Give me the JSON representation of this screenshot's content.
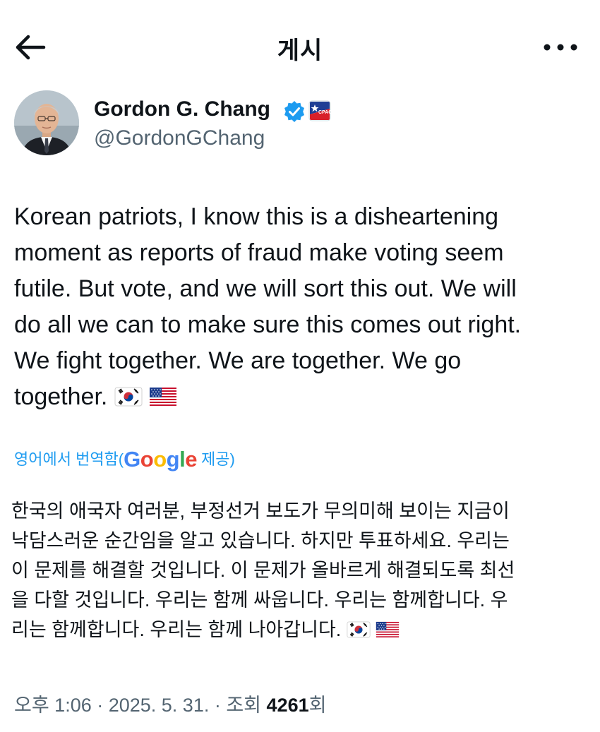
{
  "header": {
    "title": "게시",
    "back_icon": "arrow-left-icon",
    "more_icon": "more-horizontal-icon"
  },
  "author": {
    "name": "Gordon G. Chang",
    "handle": "@GordonGChang",
    "verified_color": "#1d9bf0",
    "affiliation_badge": "CPAC"
  },
  "tweet": {
    "text": "Korean patriots, I know this is a disheartening\nmoment as reports of fraud make voting seem\nfutile. But vote, and we will sort this out. We will\ndo all we can to make sure this comes out right.\nWe fight together. We are together. We go\ntogether.",
    "flags": [
      "kr-flag-icon",
      "us-flag-icon"
    ]
  },
  "translation": {
    "prefix": "영어에서 번역함(",
    "provider": "Google",
    "suffix": " 제공)",
    "text": "한국의 애국자 여러분, 부정선거 보도가 무의미해 보이는 지금이\n낙담스러운 순간임을 알고 있습니다. 하지만 투표하세요. 우리는\n이 문제를 해결할 것입니다. 이 문제가 올바르게 해결되도록 최선\n을 다할 것입니다. 우리는 함께 싸웁니다. 우리는 함께합니다. 우\n리는 함께합니다. 우리는 함께 나아갑니다."
  },
  "meta": {
    "time": "오후 1:06 · 2025. 5. 31. · 조회 ",
    "views": "4261",
    "views_suffix": "회"
  },
  "colors": {
    "link": "#1d9bf0",
    "secondary_text": "#536471",
    "primary_text": "#0f1419"
  }
}
